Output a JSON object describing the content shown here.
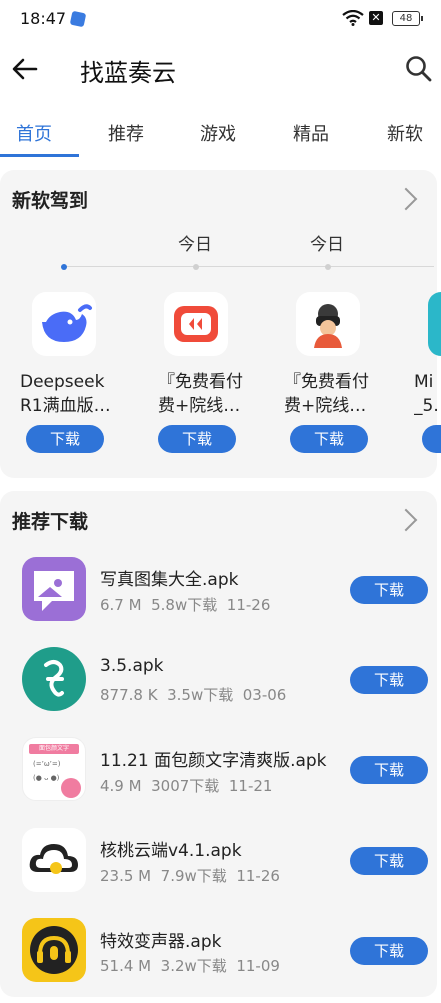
{
  "status_bar": {
    "time": "18:47",
    "battery": "48"
  },
  "app_bar": {
    "title": "找蓝奏云"
  },
  "tabs": [
    {
      "label": "首页",
      "active": true
    },
    {
      "label": "推荐"
    },
    {
      "label": "游戏"
    },
    {
      "label": "精品"
    },
    {
      "label": "新软"
    }
  ],
  "new_section": {
    "title": "新软驾到",
    "timeline_labels": [
      "今日",
      "今日"
    ],
    "apps": [
      {
        "name_line1": "Deepseek",
        "name_line2": "R1满血版…",
        "button": "下载",
        "icon": "whale-icon"
      },
      {
        "name_line1": "『免费看付",
        "name_line2": "费+院线…",
        "button": "下载",
        "icon": "video-play-icon"
      },
      {
        "name_line1": "『免费看付",
        "name_line2": "费+院线…",
        "button": "下载",
        "icon": "vr-avatar-icon"
      },
      {
        "name_line1": "Mi",
        "name_line2": "_5.",
        "button": "",
        "icon": "teal-app-icon"
      }
    ]
  },
  "rec_section": {
    "title": "推荐下载",
    "items": [
      {
        "name": "写真图集大全.apk",
        "size": "6.7 M",
        "downloads": "5.8w下载",
        "date": "11-26",
        "button": "下载",
        "icon": "photo-album-icon"
      },
      {
        "name": "3.5.apk",
        "size": "877.8 K",
        "downloads": "3.5w下载",
        "date": "03-06",
        "button": "下载",
        "icon": "teal-s-icon"
      },
      {
        "name": "11.21 面包颜文字清爽版.apk",
        "size": "4.9 M",
        "downloads": "3007下载",
        "date": "11-21",
        "button": "下载",
        "icon": "kaomoji-icon",
        "icon_text": "面包颜文字"
      },
      {
        "name": "核桃云端v4.1.apk",
        "size": "23.5 M",
        "downloads": "7.9w下载",
        "date": "11-26",
        "button": "下载",
        "icon": "cloud-icon"
      },
      {
        "name": "特效变声器.apk",
        "size": "51.4 M",
        "downloads": "3.2w下载",
        "date": "11-09",
        "button": "下载",
        "icon": "headphone-mic-icon"
      }
    ]
  },
  "colors": {
    "accent": "#2f74d8",
    "card_bg": "#f5f5f5"
  }
}
